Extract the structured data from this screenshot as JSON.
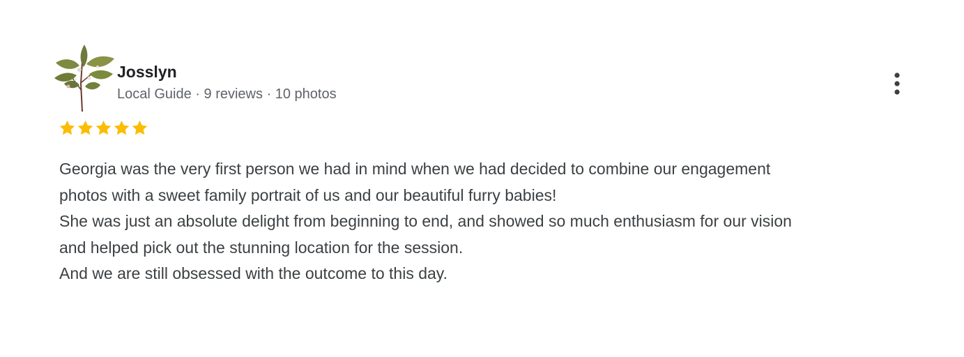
{
  "reviewer": {
    "name": "Josslyn",
    "meta": "Local Guide · 9 reviews · 10 photos",
    "avatar_icon": "pressed-leaf-sprig-avatar"
  },
  "rating": {
    "stars": 5,
    "max": 5,
    "color": "#fbbc04",
    "icon": "star-icon"
  },
  "more_options": {
    "icon": "three-dot-vertical-icon"
  },
  "review": {
    "lines": [
      "Georgia was the very first person we had in mind when we had decided to combine our engagement",
      "photos with a sweet family portrait of us and our beautiful furry babies!",
      "She was just an absolute delight from beginning to end, and showed so much enthusiasm for our vision",
      "and helped pick out the stunning location for the session.",
      "And we are still obsessed with the outcome to this day."
    ]
  }
}
